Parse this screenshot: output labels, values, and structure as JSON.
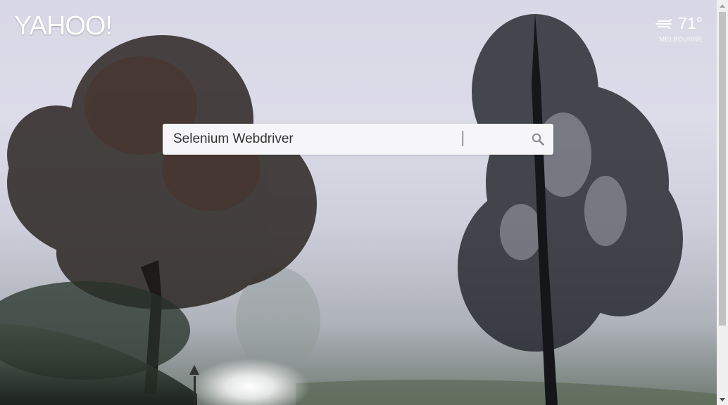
{
  "brand": {
    "logo_text": "YAHOO!"
  },
  "weather": {
    "icon": "wind-icon",
    "temperature": "71°",
    "location": "MELBOURNE"
  },
  "search": {
    "value": "Selenium Webdriver",
    "button_icon": "search-icon"
  },
  "colors": {
    "logo": "#ffffff",
    "search_bg": "#f6f6f8",
    "search_icon": "#8a8a8a"
  }
}
